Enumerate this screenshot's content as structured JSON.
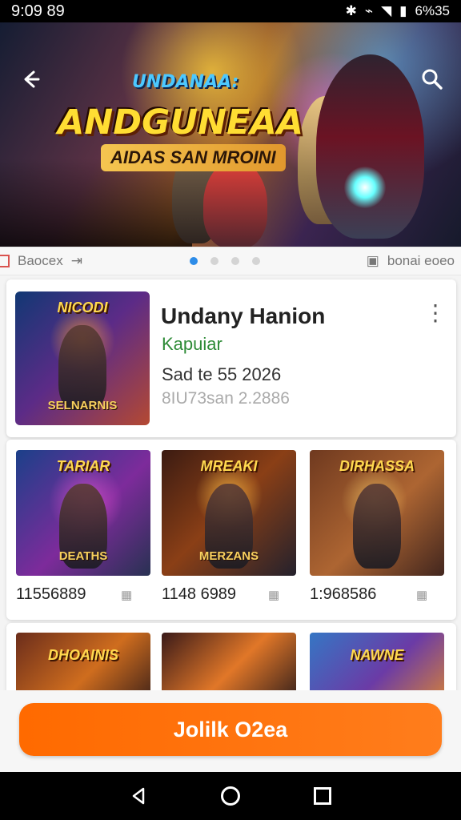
{
  "statusbar": {
    "time": "9:09  89",
    "battery": "6%35"
  },
  "banner": {
    "kicker": "UNDANAA:",
    "title": "ANDGUNEAA",
    "subtitle": "AIDAS SAN MROINI"
  },
  "indicator": {
    "left_label": "Baocex",
    "right_label": "bonai eoeo"
  },
  "featured": {
    "thumbnail_title": "NICODI",
    "thumbnail_subtitle": "SELNARNIS",
    "title": "Undany Hanion",
    "subtitle": "Kapuiar",
    "date": "Sad te 55 2026",
    "meta": "8IU73san 2.2886"
  },
  "grid": [
    {
      "name": "TARIAR",
      "subtitle": "DEATHS",
      "stat": "11556889"
    },
    {
      "name": "MREAKI",
      "subtitle": "MERZANS",
      "stat": "1148 6989"
    },
    {
      "name": "DIRHASSA",
      "subtitle": "",
      "stat": "1:968586"
    }
  ],
  "lower_grid": [
    {
      "name": "DHOAINIS"
    },
    {
      "name": ""
    },
    {
      "name": "NAWNE"
    }
  ],
  "cta": {
    "label": "Jolilk O2ea"
  },
  "colors": {
    "accent": "#ff6a00",
    "subtitle_green": "#2e8b37",
    "active_dot": "#2d8ce8"
  },
  "icons": {
    "back": "arrow-left-icon",
    "search": "search-icon",
    "more": "more-vertical-icon",
    "nav_back": "triangle-left-icon",
    "nav_home": "circle-home-icon",
    "nav_recent": "square-recent-icon"
  }
}
